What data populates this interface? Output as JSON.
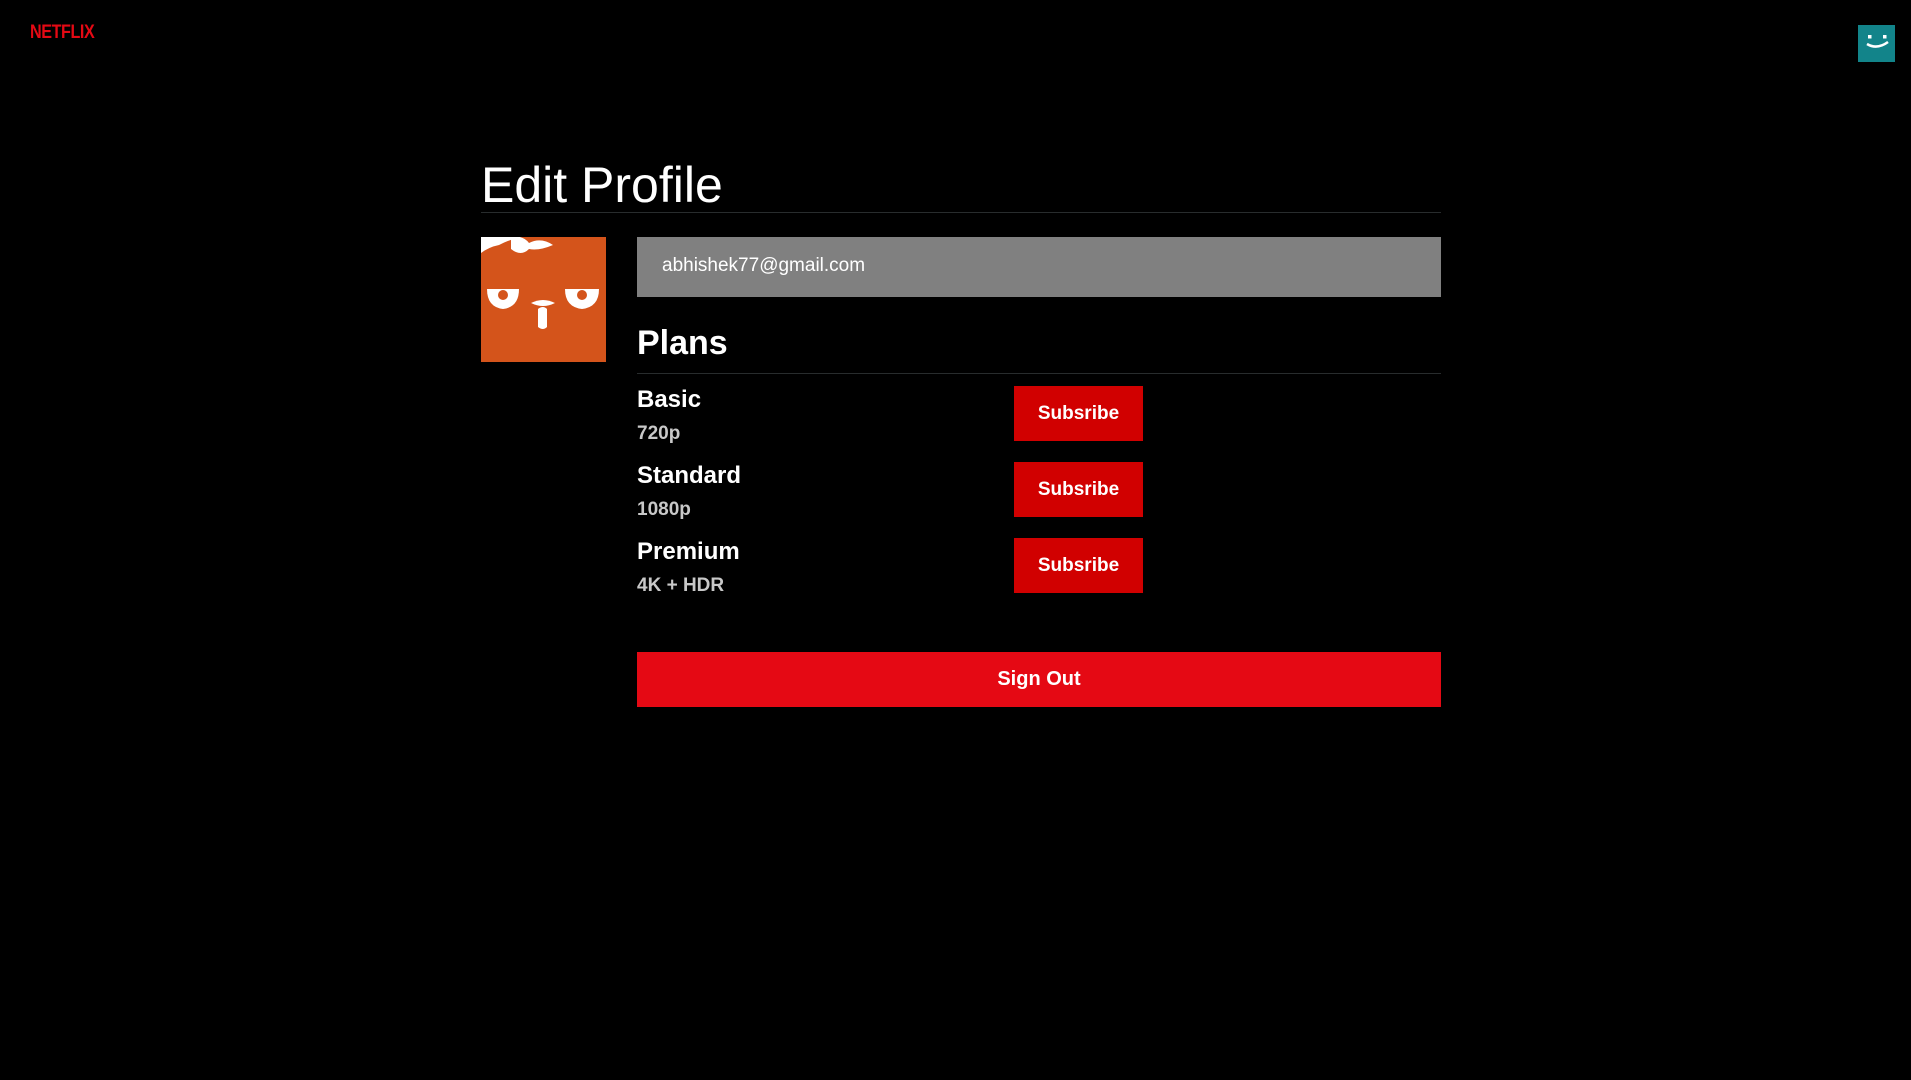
{
  "nav": {
    "logo_text": "NETFLIX",
    "avatar_icon": "smiley-avatar-icon",
    "avatar_color": "#12848a"
  },
  "page": {
    "title": "Edit Profile"
  },
  "profile": {
    "avatar_icon": "profile-avatar-icon",
    "avatar_color": "#d4541b",
    "email": "abhishek77@gmail.com"
  },
  "plans": {
    "heading": "Plans",
    "items": [
      {
        "name": "Basic",
        "resolution": "720p",
        "button_label": "Subsribe"
      },
      {
        "name": "Standard",
        "resolution": "1080p",
        "button_label": "Subsribe"
      },
      {
        "name": "Premium",
        "resolution": "4K + HDR",
        "button_label": "Subsribe"
      }
    ]
  },
  "signout_label": "Sign Out",
  "colors": {
    "brand_red": "#e50914",
    "subscribe_red": "#d10000",
    "email_bg": "#808080",
    "background": "#000000"
  }
}
